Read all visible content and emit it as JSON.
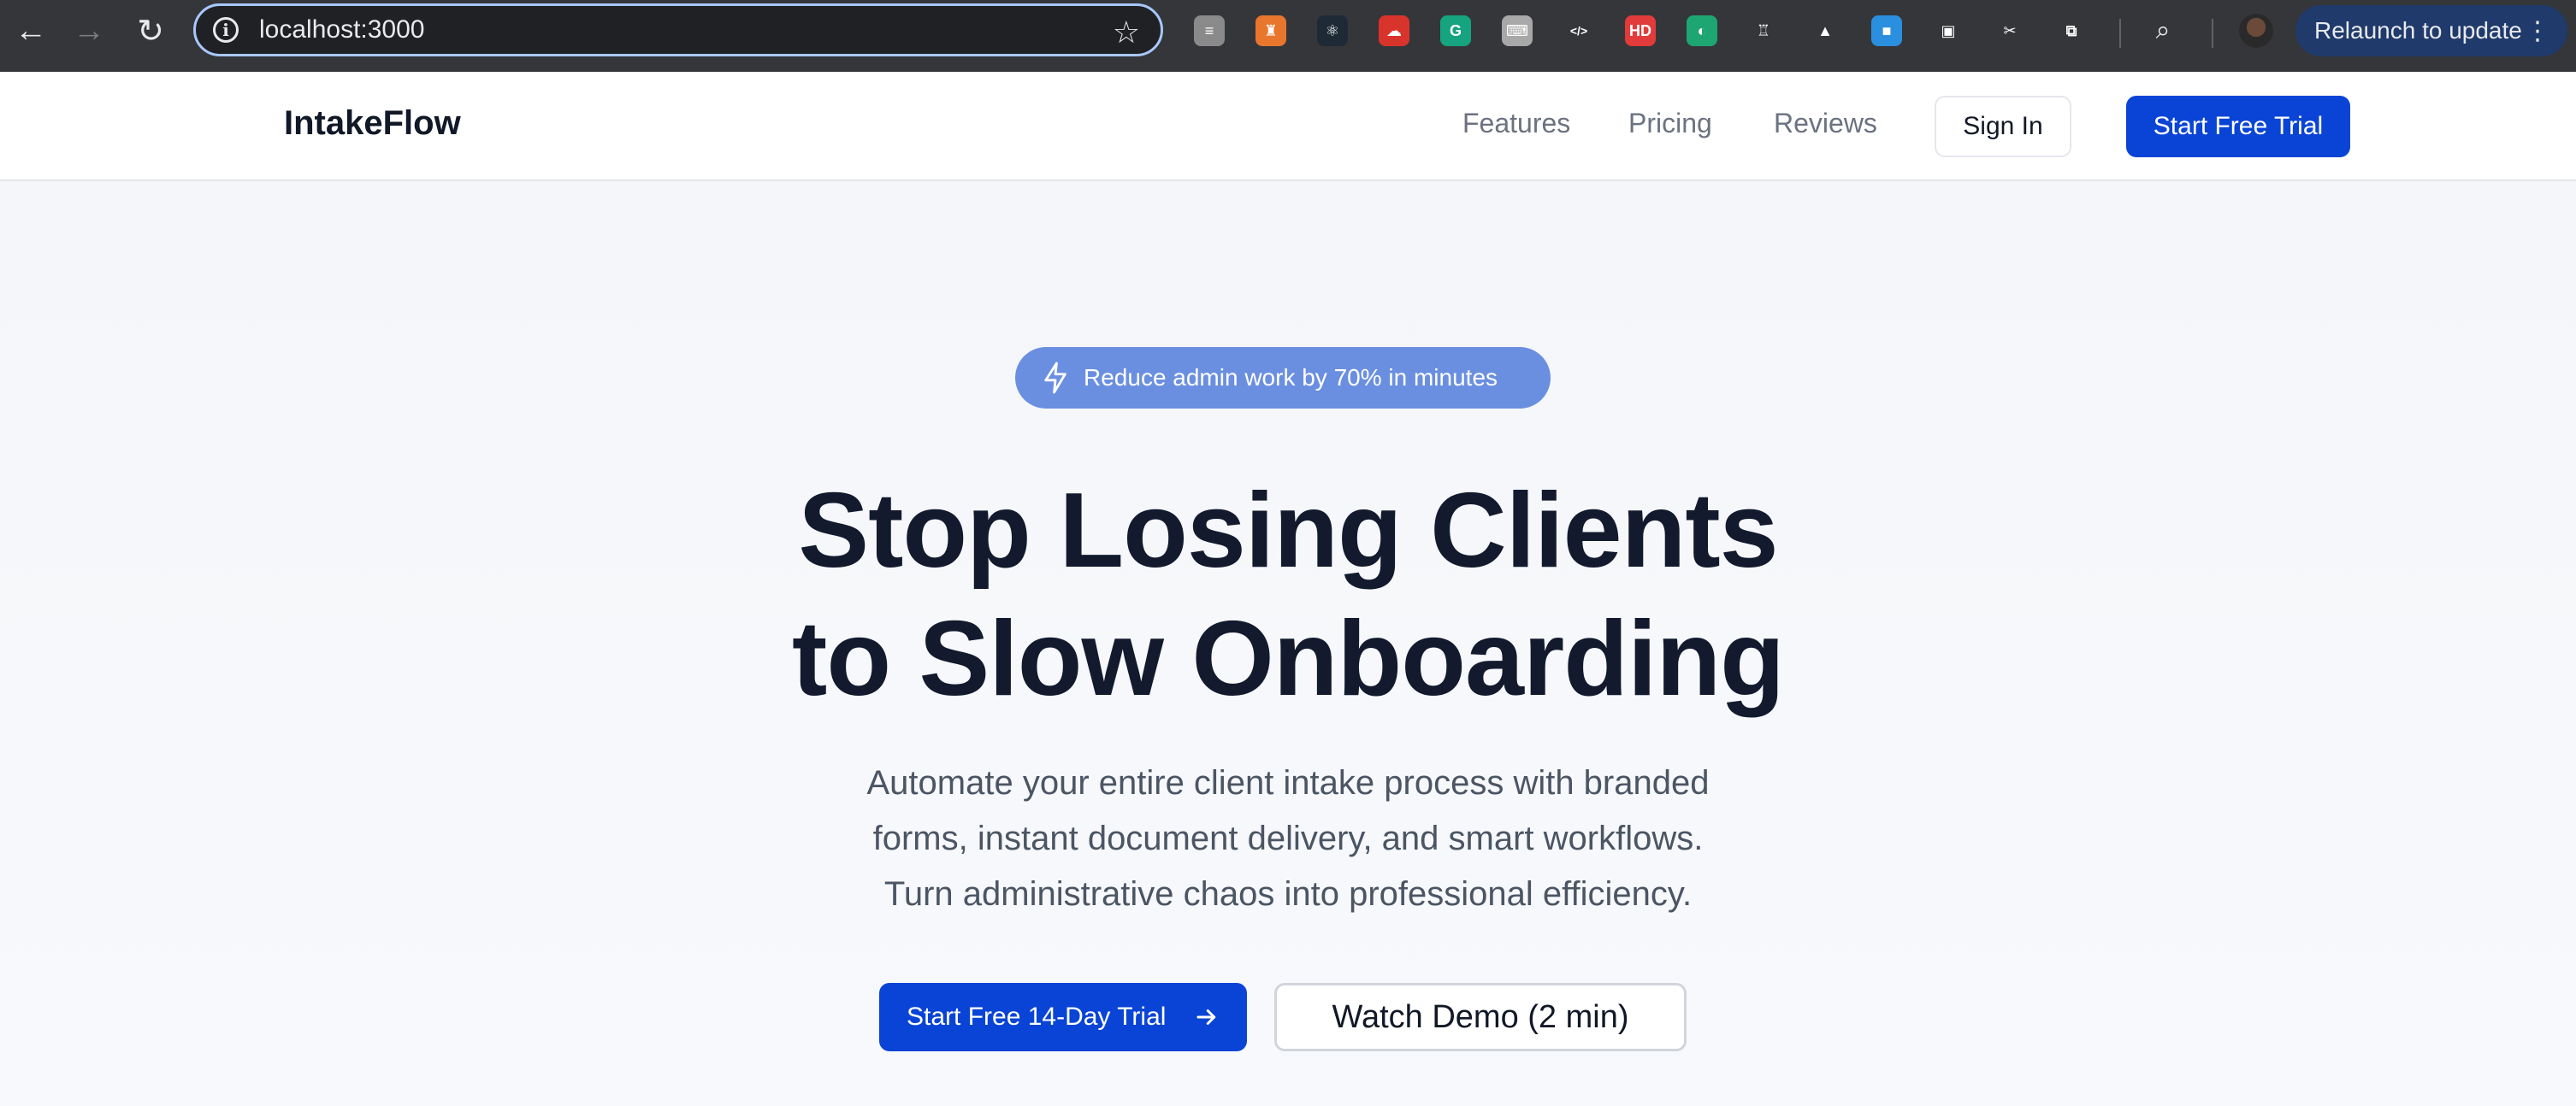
{
  "browser": {
    "url": "localhost:3000",
    "relaunch_label": "Relaunch to update",
    "extensions": [
      {
        "name": "sketch-extension-icon",
        "color": "#8a8a8a",
        "glyph": "≡"
      },
      {
        "name": "pocket-hero-extension-icon",
        "color": "#e8762c",
        "glyph": "♜"
      },
      {
        "name": "react-devtools-icon",
        "color": "#1e2a35",
        "glyph": "⚛"
      },
      {
        "name": "mind-extension-icon",
        "color": "#d9342b",
        "glyph": "☁"
      },
      {
        "name": "grammarly-icon",
        "color": "#16a37f",
        "glyph": "G"
      },
      {
        "name": "keyboard-extension-icon",
        "color": "#a8a8a8",
        "glyph": "⌨"
      },
      {
        "name": "code-extension-icon",
        "color": "#35363a",
        "glyph": "</>"
      },
      {
        "name": "hd-extension-icon",
        "color": "#e23b3b",
        "glyph": "HD"
      },
      {
        "name": "dashboard-extension-icon",
        "color": "#1ea672",
        "glyph": "◐"
      },
      {
        "name": "tools-extension-icon",
        "color": "#35363a",
        "glyph": "♖"
      },
      {
        "name": "google-drive-icon",
        "color": "#35363a",
        "glyph": "▲"
      },
      {
        "name": "toolbox-extension-icon",
        "color": "#2b8fe0",
        "glyph": "■"
      },
      {
        "name": "screen-extension-icon",
        "color": "#35363a",
        "glyph": "▣"
      },
      {
        "name": "bow-extension-icon",
        "color": "#35363a",
        "glyph": "✂"
      },
      {
        "name": "puzzle-extensions-icon",
        "color": "#35363a",
        "glyph": "⧉"
      }
    ]
  },
  "site": {
    "logo": "IntakeFlow",
    "nav": {
      "features": "Features",
      "pricing": "Pricing",
      "reviews": "Reviews"
    },
    "sign_in": "Sign In",
    "start_trial": "Start Free Trial"
  },
  "hero": {
    "badge": "Reduce admin work by 70% in minutes",
    "headline_line1": "Stop Losing Clients",
    "headline_line2": "to Slow Onboarding",
    "subtext_line1": "Automate your entire client intake process with branded",
    "subtext_line2": "forms, instant document delivery, and smart workflows.",
    "subtext_line3": "Turn administrative chaos into professional efficiency.",
    "cta_primary": "Start Free 14-Day Trial",
    "cta_secondary": "Watch Demo (2 min)"
  },
  "colors": {
    "brand_blue": "#0a44d6",
    "badge_blue": "#6b8fe0",
    "headline": "#131a2e",
    "body_text": "#4b5563"
  }
}
